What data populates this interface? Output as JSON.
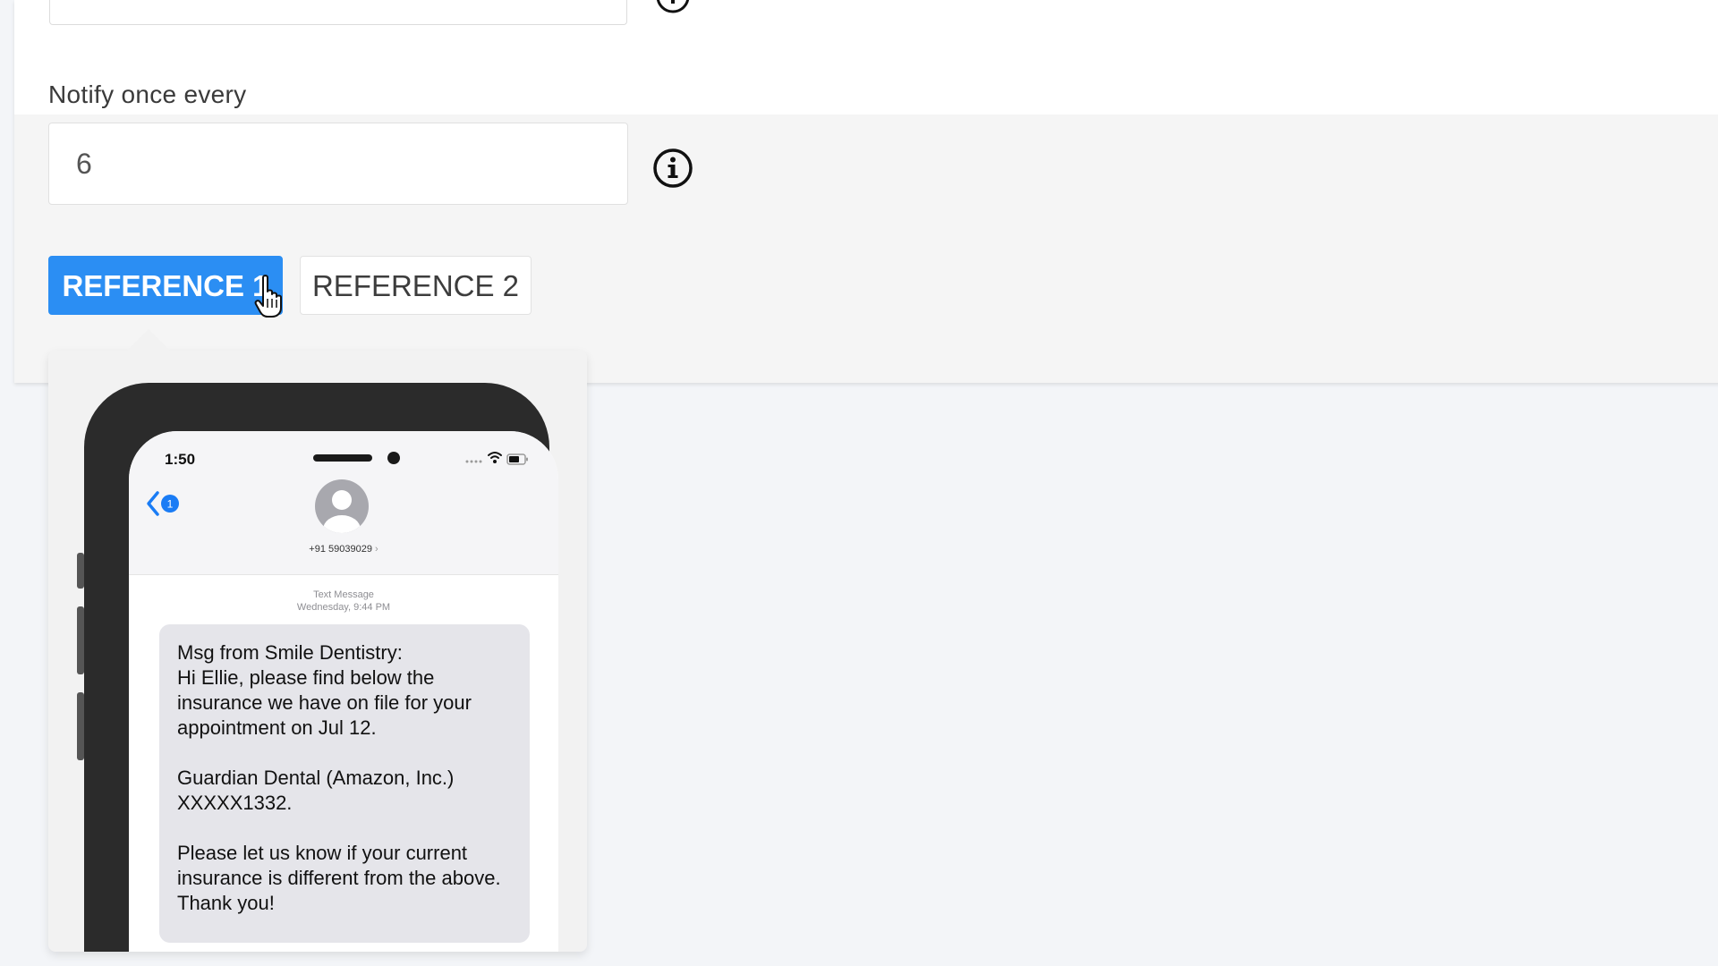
{
  "form": {
    "notify_label": "Notify once every",
    "notify_value": "6"
  },
  "references": [
    {
      "label": "REFERENCE 1",
      "active": true
    },
    {
      "label": "REFERENCE 2",
      "active": false
    }
  ],
  "preview": {
    "time": "1:50",
    "contact_number": "+91 59039029",
    "chevron": "›",
    "meta_line1": "Text Message",
    "meta_line2": "Wednesday, 9:44 PM",
    "message_p1_l1": "Msg from Smile Dentistry:",
    "message_p1_l2": "Hi Ellie, please find below the insurance we have on file for your appointment on Jul 12.",
    "message_p2_l1": "Guardian Dental (Amazon, Inc.)",
    "message_p2_l2": "XXXXX1332.",
    "message_p3": "Please let us know if your current insurance is different from the above. Thank you!",
    "unread_badge": "1"
  },
  "icons": {
    "info": "info-icon",
    "cursor": "hand-pointer-icon",
    "back": "chevron-left-icon",
    "avatar": "person-icon",
    "wifi": "wifi-icon",
    "battery": "battery-icon"
  },
  "colors": {
    "accent": "#2b8ef3",
    "card_band": "#f5f5f5",
    "bubble": "#e5e5ea",
    "ios_blue": "#1a7cf5"
  }
}
